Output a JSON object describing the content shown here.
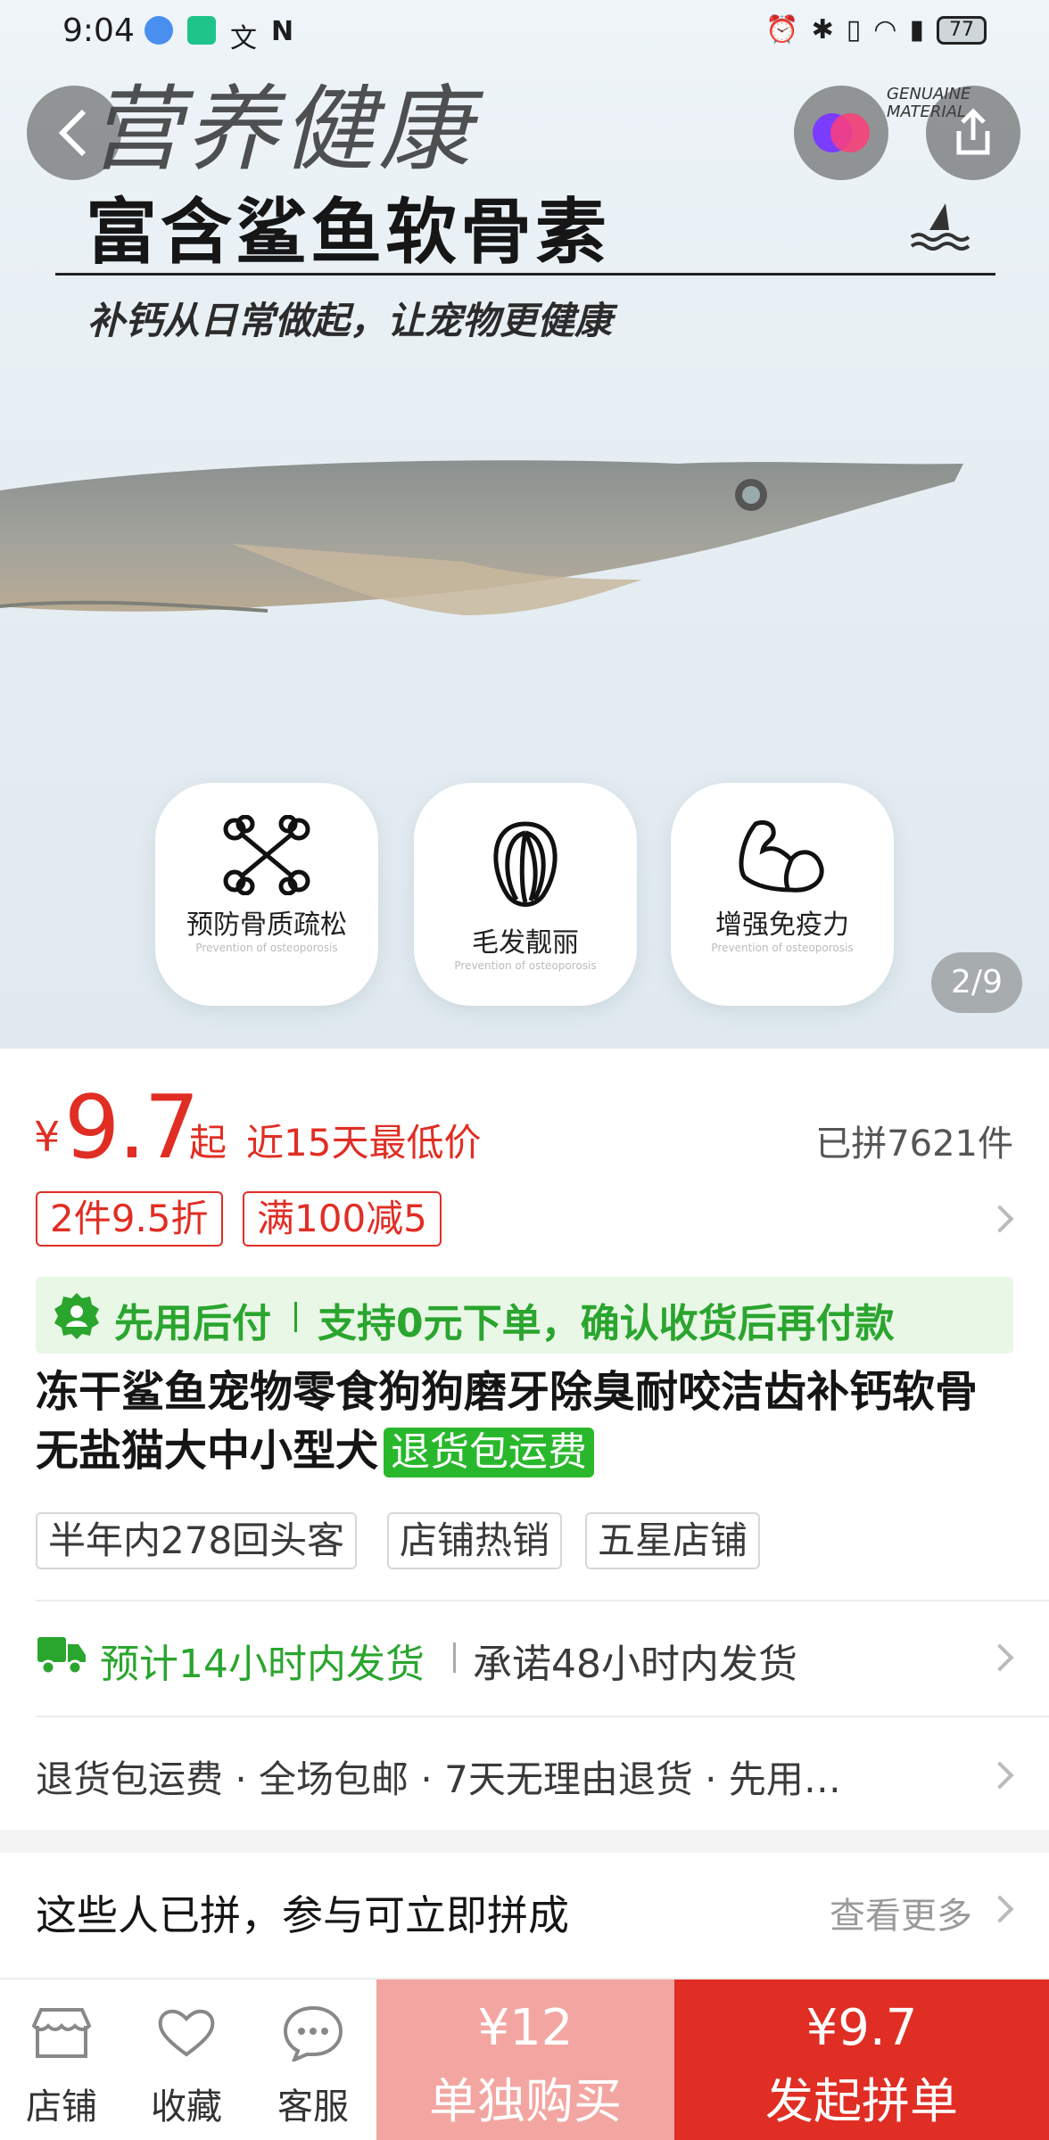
{
  "status_bar": {
    "time": "9:04",
    "battery": "77"
  },
  "hero": {
    "title": "营养健康",
    "subtitle": "富含鲨鱼软骨素",
    "tagline": "补钙从日常做起，让宠物更健康",
    "badge_text": "GENUAINE MATERIAL",
    "features": [
      {
        "label": "预防骨质疏松",
        "sub": "Prevention of osteoporosis",
        "icon": "bone-icon"
      },
      {
        "label": "毛发靓丽",
        "sub": "Prevention of osteoporosis",
        "icon": "hair-icon"
      },
      {
        "label": "增强免疫力",
        "sub": "Prevention of osteoporosis",
        "icon": "muscle-icon"
      }
    ],
    "pager": "2/9"
  },
  "price": {
    "currency": "¥",
    "value": "9.7",
    "suffix": "起",
    "note": "近15天最低价",
    "sold": "已拼7621件"
  },
  "coupons": [
    "2件9.5折",
    "满100减5"
  ],
  "pay_later": {
    "title": "先用后付",
    "desc": "支持0元下单，确认收货后再付款"
  },
  "product": {
    "title": "冻干鲨鱼宠物零食狗狗磨牙除臭耐咬洁齿补钙软骨无盐猫大中小型犬",
    "badge": "退货包运费"
  },
  "store_tags": [
    "半年内278回头客",
    "店铺热销",
    "五星店铺"
  ],
  "shipping": {
    "estimate": "预计14小时内发货",
    "promise": "承诺48小时内发货"
  },
  "services": "退货包运费 · 全场包邮 · 7天无理由退货 · 先用…",
  "group": {
    "title": "这些人已拼，参与可立即拼成",
    "more": "查看更多"
  },
  "bottom_bar": {
    "store": "店铺",
    "favorite": "收藏",
    "service": "客服",
    "single_price": "¥12",
    "single_label": "单独购买",
    "group_price": "¥9.7",
    "group_label": "发起拼单"
  },
  "colors": {
    "accent": "#e02e24",
    "green": "#2aa52e",
    "light_red": "#f3a6a1"
  }
}
